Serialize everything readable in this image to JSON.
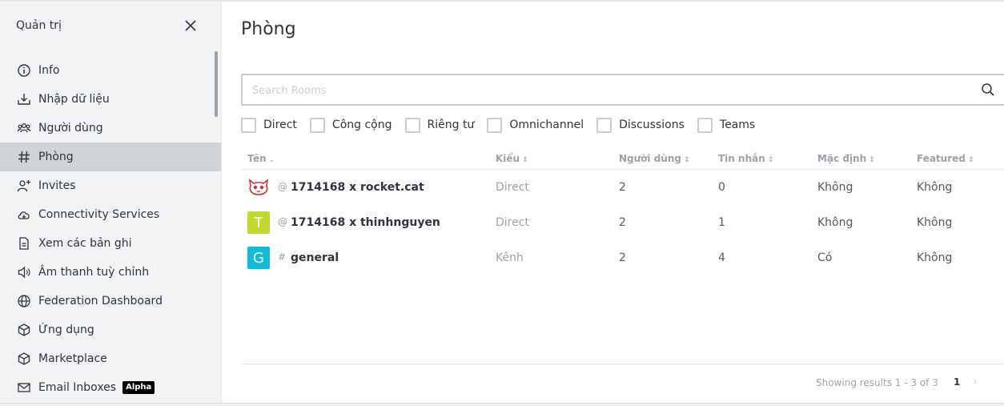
{
  "sidebar": {
    "title": "Quản trị",
    "items": [
      {
        "label": "Info",
        "icon": "info-icon"
      },
      {
        "label": "Nhập dữ liệu",
        "icon": "import-icon"
      },
      {
        "label": "Người dùng",
        "icon": "users-icon"
      },
      {
        "label": "Phòng",
        "icon": "hashtag-icon",
        "active": true
      },
      {
        "label": "Invites",
        "icon": "user-plus-icon"
      },
      {
        "label": "Connectivity Services",
        "icon": "cloud-icon"
      },
      {
        "label": "Xem các bản ghi",
        "icon": "file-icon"
      },
      {
        "label": "Âm thanh tuỳ chỉnh",
        "icon": "speaker-icon"
      },
      {
        "label": "Federation Dashboard",
        "icon": "globe-icon"
      },
      {
        "label": "Ứng dụng",
        "icon": "cube-icon"
      },
      {
        "label": "Marketplace",
        "icon": "cube-icon"
      },
      {
        "label": "Email Inboxes",
        "icon": "mail-icon",
        "badge": "Alpha"
      }
    ]
  },
  "main": {
    "title": "Phòng",
    "search": {
      "placeholder": "Search Rooms",
      "value": ""
    },
    "filters": [
      "Direct",
      "Công cộng",
      "Riêng tư",
      "Omnichannel",
      "Discussions",
      "Teams"
    ],
    "columns": [
      "Tên",
      "Kiểu",
      "Người dùng",
      "Tin nhắn",
      "Mặc định",
      "Featured"
    ],
    "rows": [
      {
        "prefix": "@",
        "name": "1714168 x rocket.cat",
        "type": "Direct",
        "users": "2",
        "messages": "0",
        "default": "Không",
        "featured": "Không",
        "avatar": "cat",
        "avatar_letter": ""
      },
      {
        "prefix": "@",
        "name": "1714168 x thinhnguyen",
        "type": "Direct",
        "users": "2",
        "messages": "1",
        "default": "Không",
        "featured": "Không",
        "avatar": "letter",
        "avatar_letter": "T",
        "avatar_color": "#c1d82f"
      },
      {
        "prefix": "#",
        "name": "general",
        "type": "Kênh",
        "users": "2",
        "messages": "4",
        "default": "Có",
        "featured": "Không",
        "avatar": "letter",
        "avatar_letter": "G",
        "avatar_color": "#14b9d5"
      }
    ],
    "pagination": {
      "text": "Showing results 1 - 3 of 3",
      "current": "1",
      "prev": "‹",
      "next": "›"
    }
  },
  "colors": {
    "accent": "#1d74f5",
    "sidebar_bg": "#f2f3f5",
    "active_bg": "#d0d3d7",
    "muted": "#9ea2a8"
  }
}
